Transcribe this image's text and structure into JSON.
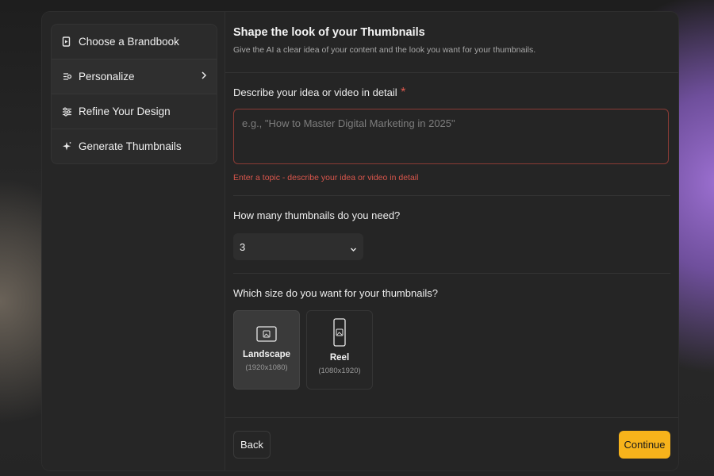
{
  "sidebar": {
    "steps": [
      {
        "label": "Choose a Brandbook",
        "icon": "brandbook-icon"
      },
      {
        "label": "Personalize",
        "icon": "personalize-icon",
        "active": true
      },
      {
        "label": "Refine Your Design",
        "icon": "sliders-icon"
      },
      {
        "label": "Generate Thumbnails",
        "icon": "sparkle-icon"
      }
    ]
  },
  "header": {
    "title": "Shape the look of your Thumbnails",
    "subtitle": "Give the AI a clear idea of your content and the look you want for your thumbnails."
  },
  "idea": {
    "label": "Describe your idea or video in detail",
    "required_mark": "*",
    "value": "",
    "placeholder": "e.g., \"How to Master Digital Marketing in 2025\"",
    "error": "Enter a topic - describe your idea or video in detail"
  },
  "count": {
    "label": "How many thumbnails do you need?",
    "value": "3"
  },
  "size": {
    "label": "Which size do you want for your thumbnails?",
    "options": [
      {
        "name": "Landscape",
        "dims": "(1920x1080)",
        "selected": true
      },
      {
        "name": "Reel",
        "dims": "(1080x1920)",
        "selected": false
      }
    ]
  },
  "footer": {
    "back_label": "Back",
    "continue_label": "Continue"
  },
  "colors": {
    "accent": "#f7b31b",
    "error": "#d9564c",
    "panel": "#252525"
  }
}
